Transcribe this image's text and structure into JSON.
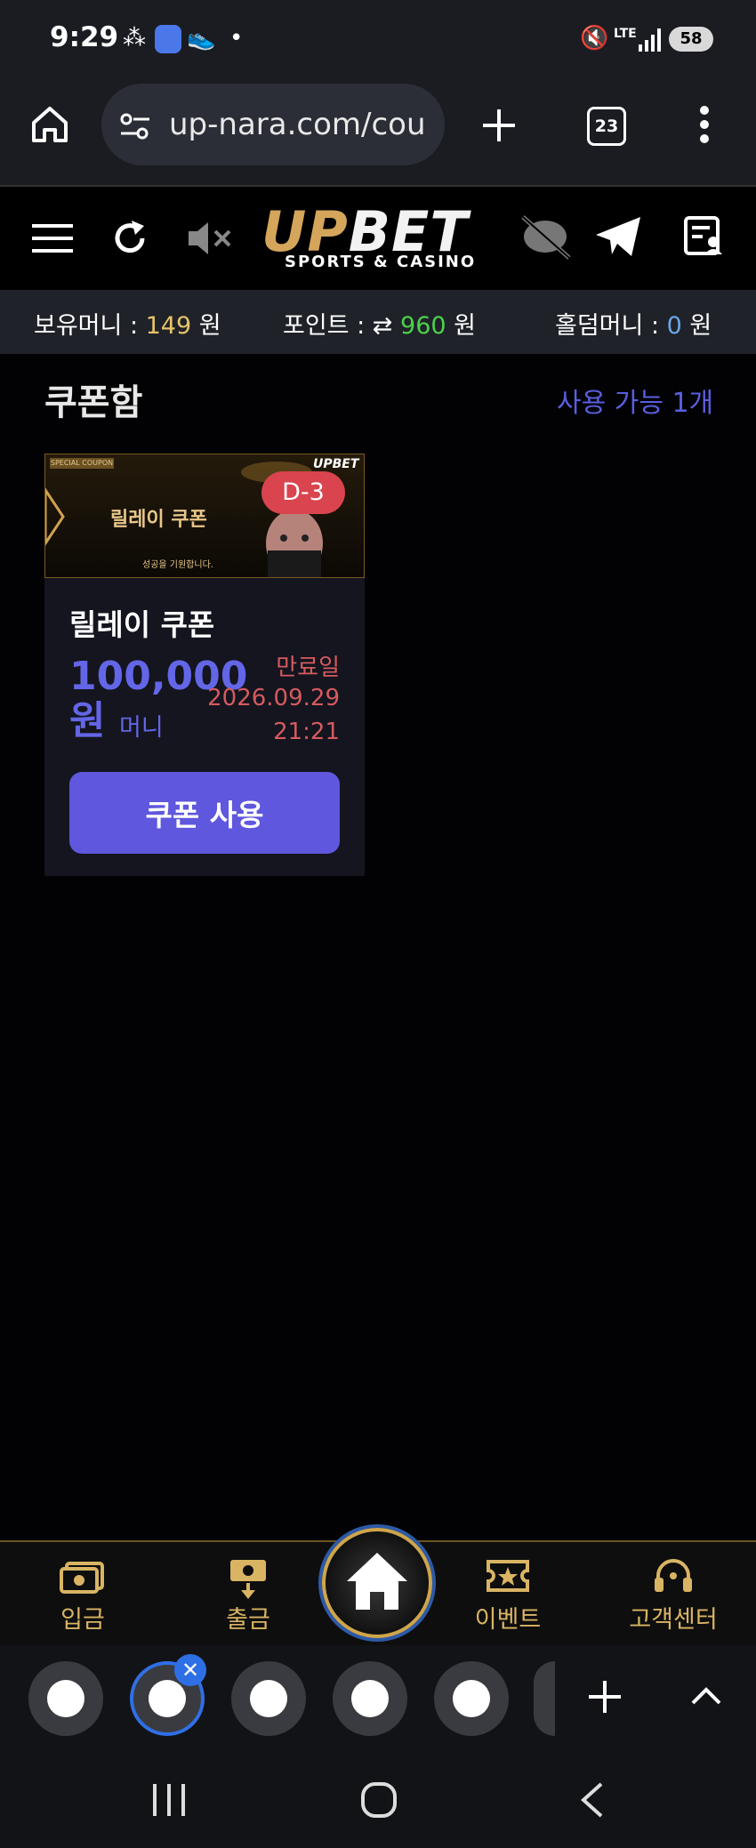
{
  "status_bar": {
    "time": "9:29",
    "dot": "•",
    "battery": "58",
    "network": "LTE"
  },
  "browser": {
    "url": "up-nara.com/cou",
    "tab_count": "23"
  },
  "site": {
    "logo_part1": "UP",
    "logo_part2": "BET",
    "logo_sub": "SPORTS & CASINO"
  },
  "balance": {
    "money_label": "보유머니 : ",
    "money_value": "149",
    "money_unit": " 원",
    "point_label": "포인트 : ",
    "point_icon": "⇄",
    "point_value": "960",
    "point_unit": " 원",
    "holdem_label": "홀덤머니 : ",
    "holdem_value": "0",
    "holdem_unit": " 원"
  },
  "coupon_box": {
    "title": "쿠폰함",
    "available": "사용 가능 1개"
  },
  "coupon": {
    "banner_tag": "SPECIAL COUPON",
    "banner_text": "릴레이 쿠폰",
    "banner_small": "성공을 기원합니다.",
    "banner_logo": "UPBET",
    "d_badge": "D-3",
    "name": "릴레이 쿠폰",
    "amount": "100,000",
    "amount_unit": "원",
    "money_type": "머니",
    "expiry_label": "만료일",
    "expiry_date": "2026.09.29",
    "expiry_time": "21:21",
    "use_button": "쿠폰 사용"
  },
  "bottom_nav": {
    "deposit": "입금",
    "withdraw": "출금",
    "events": "이벤트",
    "support": "고객센터"
  },
  "colors": {
    "accent": "#5f57dd",
    "gold": "#d9b463",
    "expiry": "#d65a5f",
    "point_green": "#4cd14c"
  }
}
